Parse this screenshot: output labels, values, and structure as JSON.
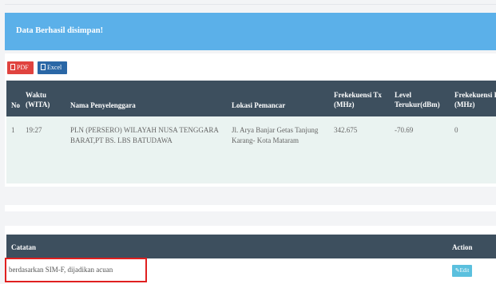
{
  "alert": {
    "message": "Data Berhasil disimpan!"
  },
  "export": {
    "pdf_label": "PDF",
    "excel_label": "Excel"
  },
  "table": {
    "headers": {
      "no": "No",
      "waktu_line1": "Waktu",
      "waktu_line2": "(WITA)",
      "penyelenggara": "Nama Penyelenggara",
      "lokasi": "Lokasi Pemancar",
      "frek_tx_line1": "Frekekuensi Tx",
      "frek_tx_line2": "(MHz)",
      "level_line1": "Level",
      "level_line2": "Terukur(dBm)",
      "frek_r_line1": "Frekekuensi R",
      "frek_r_line2": "(MHz)"
    },
    "rows": [
      {
        "no": "1",
        "waktu": "19:27",
        "penyelenggara_line1": "PLN (PERSERO) WILAYAH NUSA TENGGARA",
        "penyelenggara_line2": "BARAT,PT BS. LBS BATUDAWA",
        "lokasi_line1": "Jl. Arya Banjar Getas Tanjung",
        "lokasi_line2": "Karang- Kota Mataram",
        "frek_tx": "342.675",
        "level": "-70.69",
        "frek_r": "0"
      }
    ]
  },
  "notes": {
    "header_catatan": "Catatan",
    "header_action": "Action",
    "text": "berdasarkan SIM-F, dijadikan acuan",
    "edit_label": "Edit"
  },
  "colors": {
    "alert_bg": "#5bb0e9",
    "header_bg": "#3d4f5e",
    "pdf_btn": "#e0433f",
    "excel_btn": "#2a67a6",
    "edit_btn": "#5bc0de",
    "highlight_border": "#e02020"
  },
  "icons": {
    "pdf": "file-pdf-icon",
    "excel": "file-excel-icon",
    "edit": "pencil-icon"
  }
}
